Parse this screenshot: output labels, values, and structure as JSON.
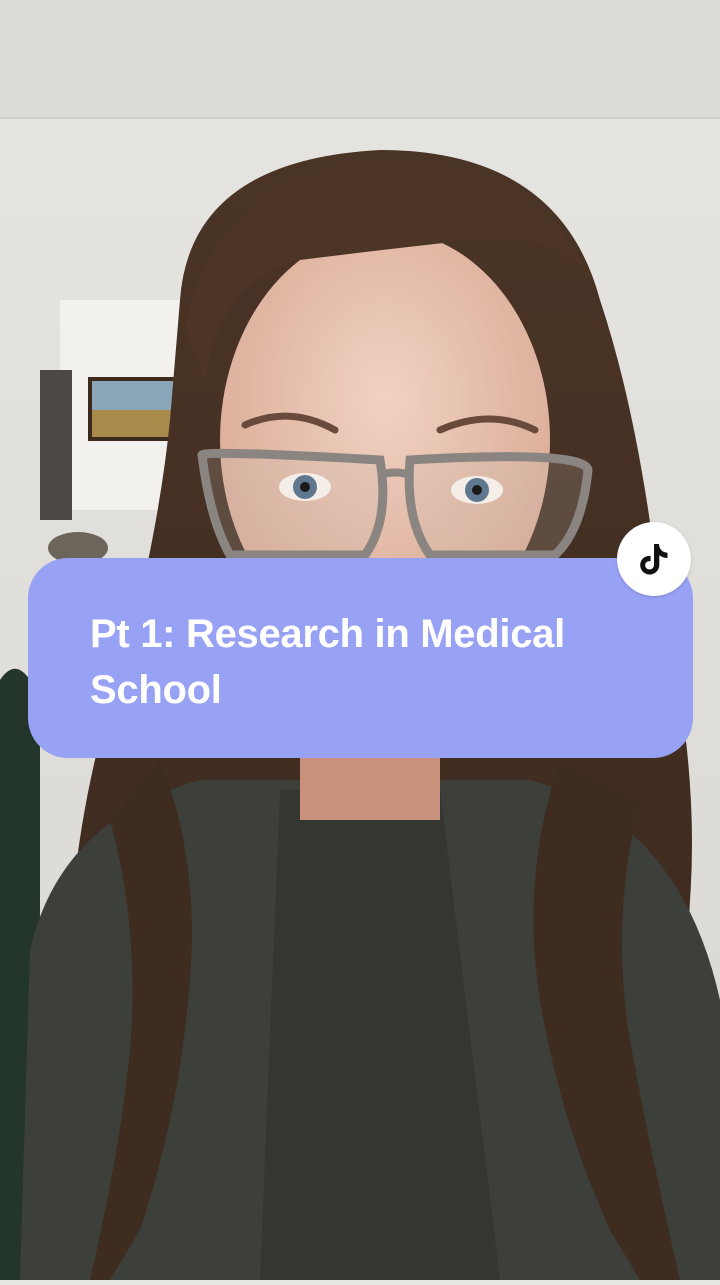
{
  "overlay": {
    "caption": "Pt 1: Research in Medical School",
    "caption_background": "#98a2f5",
    "caption_text_color": "#ffffff"
  },
  "badge": {
    "icon": "tiktok-logo-icon",
    "background": "#ffffff"
  },
  "video": {
    "subject": "person-with-glasses-and-curly-hair"
  }
}
